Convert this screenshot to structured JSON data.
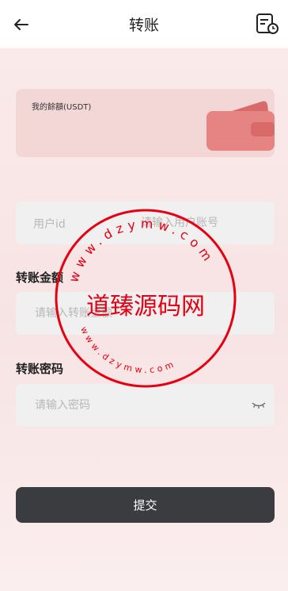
{
  "header": {
    "title": "转账",
    "back_icon": "arrow-left-icon",
    "records_icon": "document-clock-icon"
  },
  "balance": {
    "label": "我的餘額(USDT)",
    "icon": "wallet-icon"
  },
  "user": {
    "label": "用户id",
    "placeholder": "请输入用户账号"
  },
  "amount": {
    "label": "转账金额",
    "placeholder": "请输入转账金额"
  },
  "password": {
    "label": "转账密码",
    "placeholder": "请输入密码",
    "toggle_icon": "eye-closed-icon"
  },
  "submit": {
    "label": "提交"
  },
  "watermark": {
    "main_text": "道臻源码网",
    "url_text": "www.dzymw.com"
  },
  "colors": {
    "accent_red": "#e60012",
    "button_dark": "#3b3c3f",
    "card_pink": "#f3d6d6"
  }
}
